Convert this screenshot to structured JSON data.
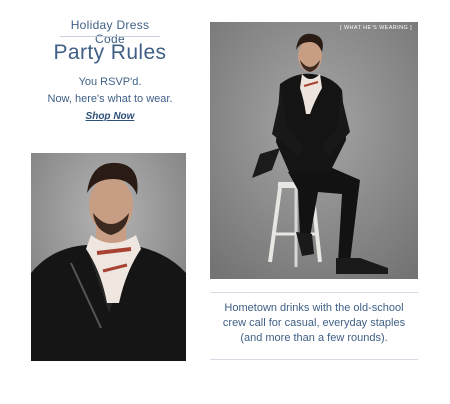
{
  "header": {
    "kicker": "Holiday Dress Code",
    "title": "Party Rules",
    "subtitle_line1": "You RSVP'd.",
    "subtitle_line2": "Now, here's what to wear.",
    "cta": "Shop Now"
  },
  "images": {
    "right_tag": "[ WHAT HE'S WEARING ]"
  },
  "caption": {
    "line1": "Hometown drinks with the old-school",
    "line2": "crew call for casual, everyday staples",
    "line3": "(and more than a few rounds)."
  }
}
